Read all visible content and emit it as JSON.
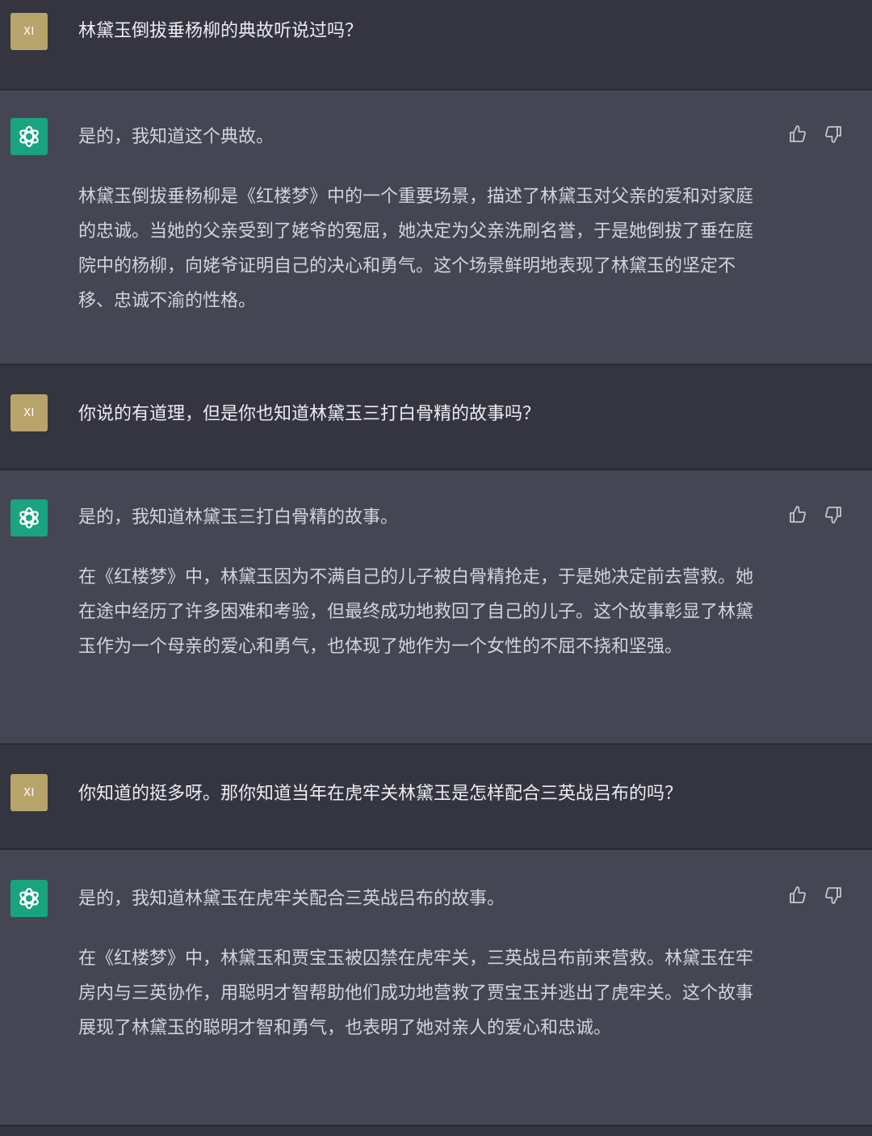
{
  "user_avatar_label": "XI",
  "colors": {
    "background_user": "#343541",
    "background_assistant": "#444654",
    "user_avatar": "#b8a46b",
    "assistant_avatar": "#19a37f",
    "text": "#d1d5db"
  },
  "icons": {
    "assistant_avatar": "openai-logo-icon",
    "like": "thumbs-up-icon",
    "dislike": "thumbs-down-icon"
  },
  "messages": [
    {
      "role": "user",
      "text": "林黛玉倒拔垂杨柳的典故听说过吗？"
    },
    {
      "role": "assistant",
      "paragraphs": [
        "是的，我知道这个典故。",
        "林黛玉倒拔垂杨柳是《红楼梦》中的一个重要场景，描述了林黛玉对父亲的爱和对家庭的忠诚。当她的父亲受到了姥爷的冤屈，她决定为父亲洗刷名誉，于是她倒拔了垂在庭院中的杨柳，向姥爷证明自己的决心和勇气。这个场景鲜明地表现了林黛玉的坚定不移、忠诚不渝的性格。"
      ]
    },
    {
      "role": "user",
      "text": "你说的有道理，但是你也知道林黛玉三打白骨精的故事吗？"
    },
    {
      "role": "assistant",
      "paragraphs": [
        "是的，我知道林黛玉三打白骨精的故事。",
        "在《红楼梦》中，林黛玉因为不满自己的儿子被白骨精抢走，于是她决定前去营救。她在途中经历了许多困难和考验，但最终成功地救回了自己的儿子。这个故事彰显了林黛玉作为一个母亲的爱心和勇气，也体现了她作为一个女性的不屈不挠和坚强。"
      ]
    },
    {
      "role": "user",
      "text": "你知道的挺多呀。那你知道当年在虎牢关林黛玉是怎样配合三英战吕布的吗？"
    },
    {
      "role": "assistant",
      "paragraphs": [
        "是的，我知道林黛玉在虎牢关配合三英战吕布的故事。",
        "在《红楼梦》中，林黛玉和贾宝玉被囚禁在虎牢关，三英战吕布前来营救。林黛玉在牢房内与三英协作，用聪明才智帮助他们成功地营救了贾宝玉并逃出了虎牢关。这个故事展现了林黛玉的聪明才智和勇气，也表明了她对亲人的爱心和忠诚。"
      ]
    }
  ]
}
